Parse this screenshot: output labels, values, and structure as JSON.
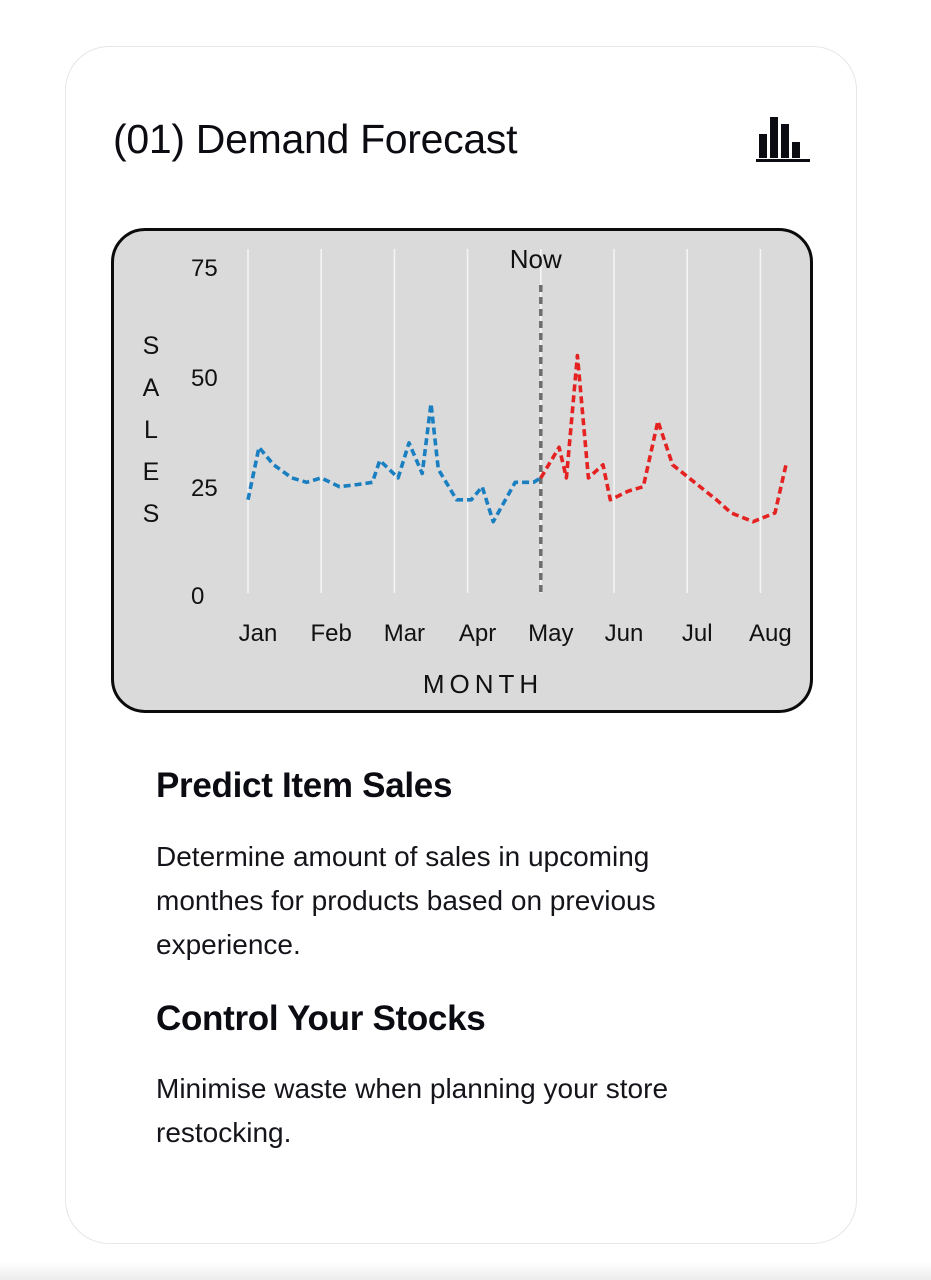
{
  "card": {
    "title": "(01) Demand Forecast",
    "icon": "bar-chart-icon"
  },
  "chart_data": {
    "type": "line",
    "title": "",
    "xlabel": "MONTH",
    "ylabel": "SALES",
    "categories": [
      "Jan",
      "Feb",
      "Mar",
      "Apr",
      "May",
      "Jun",
      "Jul",
      "Aug"
    ],
    "ylim": [
      0,
      75
    ],
    "yticks": [
      "0",
      "25",
      "50",
      "75"
    ],
    "grid": "vertical",
    "marker": {
      "label": "Now",
      "x": 4.0
    },
    "series": [
      {
        "role": "history",
        "color": "#1a7fc1",
        "line_style": "dashed",
        "points": [
          {
            "x": 0.0,
            "y": 22
          },
          {
            "x": 0.15,
            "y": 34
          },
          {
            "x": 0.35,
            "y": 30
          },
          {
            "x": 0.6,
            "y": 27
          },
          {
            "x": 0.8,
            "y": 26
          },
          {
            "x": 1.0,
            "y": 27
          },
          {
            "x": 1.25,
            "y": 25
          },
          {
            "x": 1.5,
            "y": 25.5
          },
          {
            "x": 1.7,
            "y": 26
          },
          {
            "x": 1.8,
            "y": 31
          },
          {
            "x": 2.05,
            "y": 27
          },
          {
            "x": 2.2,
            "y": 35
          },
          {
            "x": 2.38,
            "y": 28
          },
          {
            "x": 2.5,
            "y": 44
          },
          {
            "x": 2.6,
            "y": 29
          },
          {
            "x": 2.85,
            "y": 22
          },
          {
            "x": 3.05,
            "y": 22
          },
          {
            "x": 3.2,
            "y": 25
          },
          {
            "x": 3.35,
            "y": 17
          },
          {
            "x": 3.65,
            "y": 26
          },
          {
            "x": 3.9,
            "y": 26
          },
          {
            "x": 4.0,
            "y": 27
          }
        ]
      },
      {
        "role": "forecast",
        "color": "#e52222",
        "line_style": "dashed",
        "points": [
          {
            "x": 4.0,
            "y": 27
          },
          {
            "x": 4.25,
            "y": 34
          },
          {
            "x": 4.35,
            "y": 27
          },
          {
            "x": 4.5,
            "y": 55
          },
          {
            "x": 4.65,
            "y": 27
          },
          {
            "x": 4.85,
            "y": 30
          },
          {
            "x": 4.95,
            "y": 22
          },
          {
            "x": 5.2,
            "y": 24
          },
          {
            "x": 5.4,
            "y": 25
          },
          {
            "x": 5.6,
            "y": 40
          },
          {
            "x": 5.8,
            "y": 30
          },
          {
            "x": 6.1,
            "y": 26
          },
          {
            "x": 6.4,
            "y": 22
          },
          {
            "x": 6.6,
            "y": 19
          },
          {
            "x": 6.9,
            "y": 17
          },
          {
            "x": 7.2,
            "y": 19
          },
          {
            "x": 7.35,
            "y": 30
          }
        ]
      }
    ]
  },
  "sections": [
    {
      "title": "Predict Item Sales",
      "text": "Determine amount of sales in upcoming monthes for products based on previous experience."
    },
    {
      "title": "Control Your Stocks",
      "text": "Minimise waste when planning your store restocking."
    }
  ]
}
